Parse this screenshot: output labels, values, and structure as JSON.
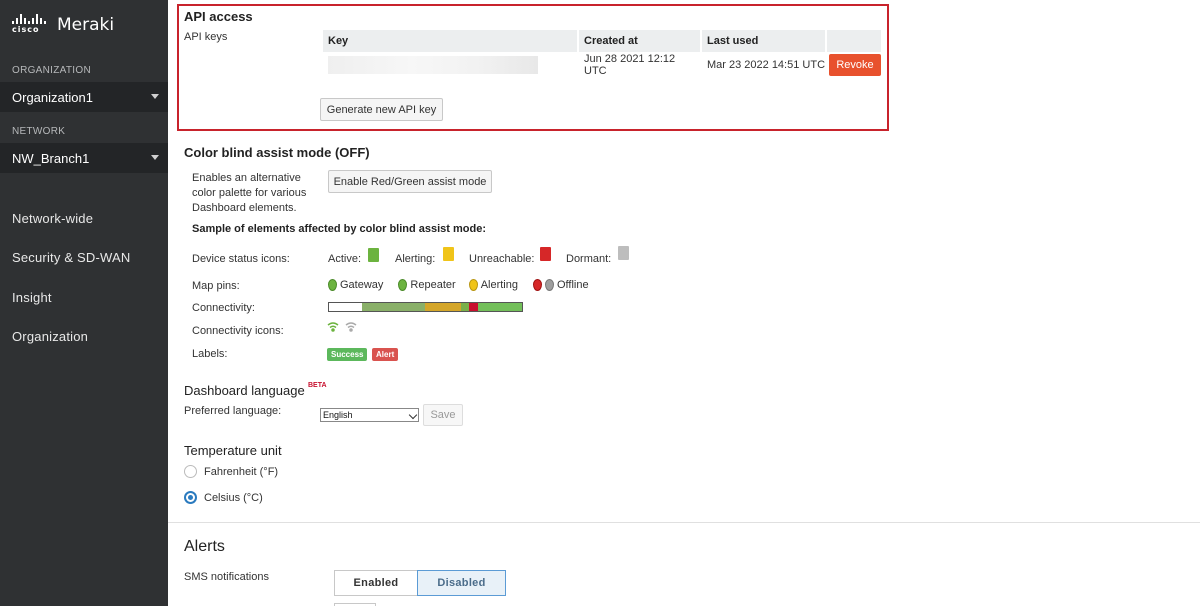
{
  "brand": {
    "cisco": "cisco",
    "product": "Meraki"
  },
  "sidebar": {
    "org_caption": "ORGANIZATION",
    "org_value": "Organization1",
    "net_caption": "NETWORK",
    "net_value": "NW_Branch1",
    "nav": [
      "Network-wide",
      "Security & SD-WAN",
      "Insight",
      "Organization"
    ]
  },
  "api": {
    "title": "API access",
    "keys_label": "API keys",
    "columns": [
      "Key",
      "Created at",
      "Last used",
      ""
    ],
    "row": {
      "created": "Jun 28 2021 12:12 UTC",
      "last_used": "Mar 23 2022 14:51 UTC",
      "revoke": "Revoke"
    },
    "generate": "Generate new API key"
  },
  "colorblind": {
    "title": "Color blind assist mode (OFF)",
    "description": [
      "Enables an alternative",
      "color palette for various",
      "Dashboard elements."
    ],
    "button": "Enable Red/Green assist mode",
    "sample_title": "Sample of elements affected by color blind assist mode:",
    "device_status_label": "Device status icons:",
    "statuses": [
      "Active:",
      "Alerting:",
      "Unreachable:",
      "Dormant:"
    ],
    "map_pins_label": "Map pins:",
    "pins": [
      "Gateway",
      "Repeater",
      "Alerting",
      "Offline"
    ],
    "connectivity_label": "Connectivity:",
    "connectivity_icons_label": "Connectivity icons:",
    "labels_label": "Labels:",
    "tags": [
      "Success",
      "Alert"
    ],
    "colors": {
      "green": "#6cb33f",
      "yellow": "#f0c419",
      "red": "#d62728",
      "gray": "#bdbdbd"
    }
  },
  "language": {
    "title": "Dashboard language",
    "beta": "BETA",
    "preferred_label": "Preferred language:",
    "selected": "English",
    "save": "Save"
  },
  "temperature": {
    "title": "Temperature unit",
    "options": [
      "Fahrenheit (°F)",
      "Celsius (°C)"
    ],
    "selected": "Celsius (°C)"
  },
  "alerts": {
    "title": "Alerts",
    "sms_label": "SMS notifications",
    "enabled": "Enabled",
    "disabled": "Disabled",
    "selected": "Disabled"
  }
}
